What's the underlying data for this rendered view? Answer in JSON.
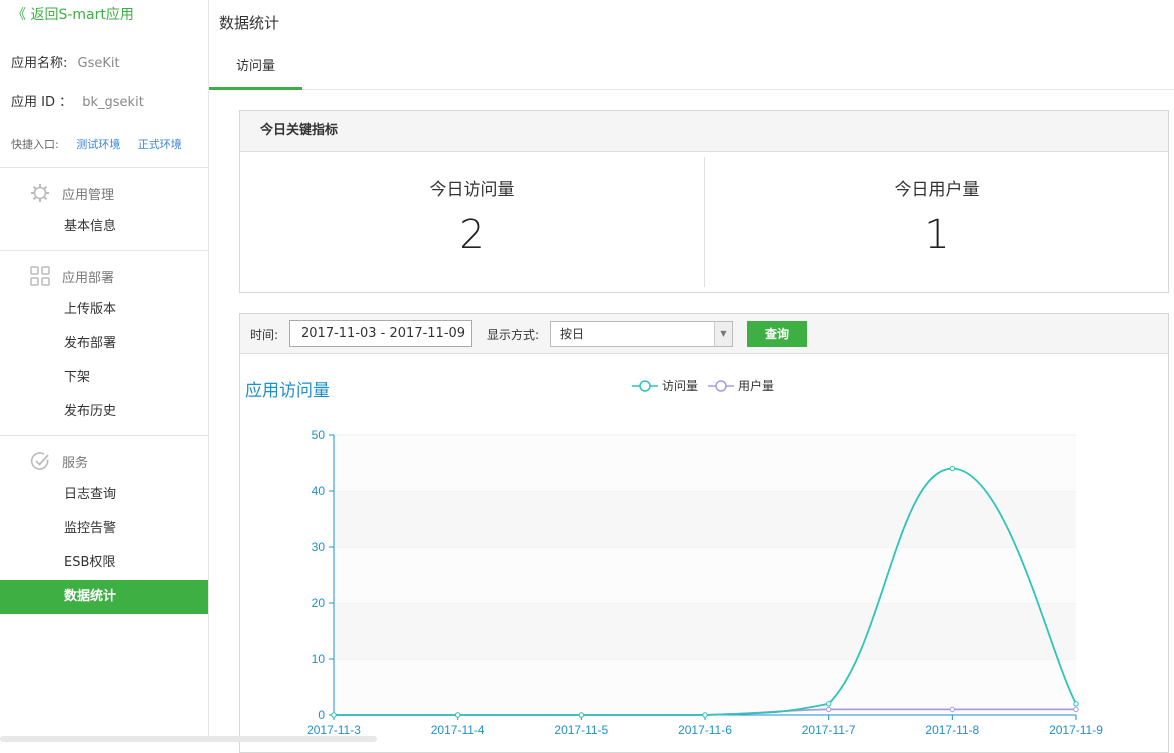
{
  "sidebar": {
    "back_label": "《 返回S-mart应用",
    "app_name_label": "应用名称:",
    "app_name_value": "GseKit",
    "app_id_label": "应用 ID ：",
    "app_id_value": "bk_gsekit",
    "quick_label": "快捷入口:",
    "quick_links": [
      "测试环境",
      "正式环境"
    ],
    "groups": [
      {
        "title": "应用管理",
        "icon": "gear-icon",
        "items": [
          "基本信息"
        ]
      },
      {
        "title": "应用部署",
        "icon": "grid-icon",
        "items": [
          "上传版本",
          "发布部署",
          "下架",
          "发布历史"
        ]
      },
      {
        "title": "服务",
        "icon": "check-circle-icon",
        "items": [
          "日志查询",
          "监控告警",
          "ESB权限",
          "数据统计"
        ]
      }
    ],
    "active_item": "数据统计"
  },
  "header": {
    "title": "数据统计",
    "tabs": [
      "访问量"
    ]
  },
  "key_metrics": {
    "title": "今日关键指标",
    "visits_label": "今日访问量",
    "visits_value": "2",
    "users_label": "今日用户量",
    "users_value": "1"
  },
  "filter": {
    "time_label": "时间:",
    "date_range": "2017-11-03 - 2017-11-09",
    "mode_label": "显示方式:",
    "mode_value": "按日",
    "query_label": "查询"
  },
  "colors": {
    "accent": "#3eb043",
    "visits": "#2ec4b6",
    "users": "#a99be0",
    "axis": "#1e90c8"
  },
  "chart_data": {
    "type": "line",
    "title": "应用访问量",
    "x": [
      "2017-11-3",
      "2017-11-4",
      "2017-11-5",
      "2017-11-6",
      "2017-11-7",
      "2017-11-8",
      "2017-11-9"
    ],
    "series": [
      {
        "name": "访问量",
        "values": [
          0,
          0,
          0,
          0,
          2,
          44,
          2
        ]
      },
      {
        "name": "用户量",
        "values": [
          0,
          0,
          0,
          0,
          1,
          1,
          1
        ]
      }
    ],
    "ylim": [
      0,
      50
    ],
    "yticks": [
      "0",
      "10",
      "20",
      "30",
      "40",
      "50"
    ],
    "legend": "top-center",
    "grid": true
  }
}
